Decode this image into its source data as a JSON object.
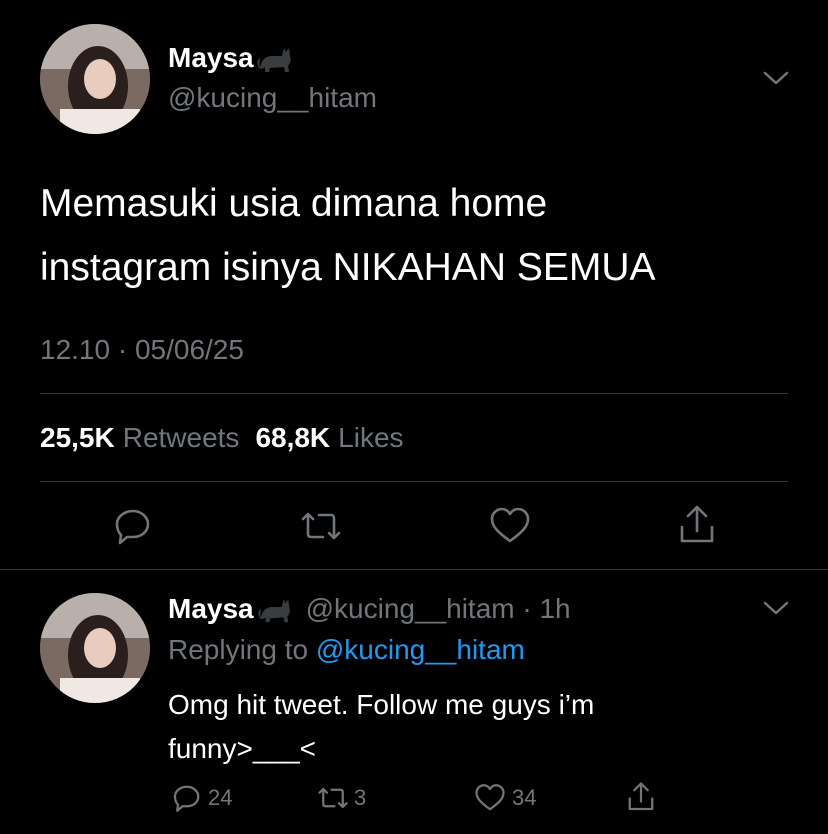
{
  "main_tweet": {
    "display_name": "Maysa",
    "name_emoji": "🐈‍⬛",
    "handle": "@kucing__hitam",
    "text_line1": "Memasuki usia dimana home",
    "text_line2": "instagram isinya NIKAHAN SEMUA",
    "timestamp": "12.10 · 05/06/25",
    "retweets_count": "25,5K",
    "retweets_label": "Retweets",
    "likes_count": "68,8K",
    "likes_label": "Likes"
  },
  "reply": {
    "display_name": "Maysa",
    "name_emoji": "🐈‍⬛",
    "handle_time": "@kucing__hitam · 1h",
    "replying_prefix": "Replying to",
    "replying_handle": "@kucing__hitam",
    "text_line1": "Omg hit tweet. Follow me guys i’m",
    "text_line2": "funny>___<",
    "reply_count": "24",
    "retweet_count": "3",
    "like_count": "34"
  },
  "icons": [
    "chevron-down-icon",
    "reply-icon",
    "retweet-icon",
    "heart-icon",
    "share-icon",
    "black-cat-icon"
  ]
}
